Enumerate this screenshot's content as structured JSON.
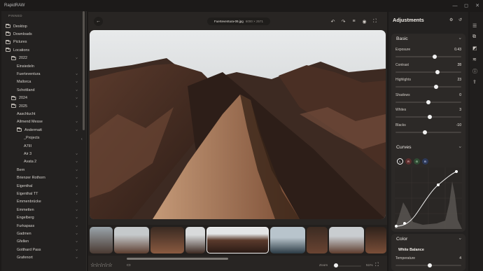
{
  "app": {
    "title": "RapidRAW"
  },
  "window_controls": {
    "minimize": "—",
    "maximize": "◻",
    "close": "✕"
  },
  "sidebar": {
    "pinned_label": "PINNED",
    "items": [
      {
        "label": "Desktop"
      },
      {
        "label": "Downloads"
      },
      {
        "label": "Pictures"
      },
      {
        "label": "Locations"
      },
      {
        "label": "2022"
      },
      {
        "label": "Einsiedeln"
      },
      {
        "label": "Fuerteventura"
      },
      {
        "label": "Mallorca"
      },
      {
        "label": "Schottland"
      },
      {
        "label": "2024"
      },
      {
        "label": "2025"
      },
      {
        "label": "Aaschlucht"
      },
      {
        "label": "Allmend Messe"
      },
      {
        "label": "Andermatt"
      },
      {
        "label": "_Projects"
      },
      {
        "label": "A7III"
      },
      {
        "label": "Air 3"
      },
      {
        "label": "Avata 2"
      },
      {
        "label": "Bern"
      },
      {
        "label": "Brienzer Rothorn"
      },
      {
        "label": "Eigenthal"
      },
      {
        "label": "Eigenthal TT"
      },
      {
        "label": "Emmenbrücke"
      },
      {
        "label": "Emmetten"
      },
      {
        "label": "Engelberg"
      },
      {
        "label": "Furkapass"
      },
      {
        "label": "Gadmen"
      },
      {
        "label": "Gfellen"
      },
      {
        "label": "Gotthard Pass"
      },
      {
        "label": "Grafenort"
      }
    ]
  },
  "editor": {
    "filename": "Fuerteventura-09.jpg",
    "dimensions": "6000 × 2571",
    "rating_stars": "☆☆☆☆☆",
    "zoom_label": "Zoom",
    "zoom_value": "51%"
  },
  "adjustments": {
    "title": "Adjustments",
    "basic": {
      "title": "Basic",
      "sliders": [
        {
          "label": "Exposure",
          "value": "0.43",
          "pos": 0.6
        },
        {
          "label": "Contrast",
          "value": "28",
          "pos": 0.64
        },
        {
          "label": "Highlights",
          "value": "23",
          "pos": 0.62
        },
        {
          "label": "Shadows",
          "value": "0",
          "pos": 0.5
        },
        {
          "label": "Whites",
          "value": "3",
          "pos": 0.52
        },
        {
          "label": "Blacks",
          "value": "-10",
          "pos": 0.45
        }
      ]
    },
    "curves": {
      "title": "Curves",
      "channels": [
        "L",
        "R",
        "G",
        "B"
      ]
    },
    "color": {
      "title": "Color",
      "white_balance": "White Balance",
      "temperature_label": "Temperature",
      "temperature_value": "4",
      "temperature_pos": 0.52
    }
  },
  "colors": {
    "accent": "#f2f2f2",
    "panel": "#232120",
    "card": "#2c2927"
  }
}
